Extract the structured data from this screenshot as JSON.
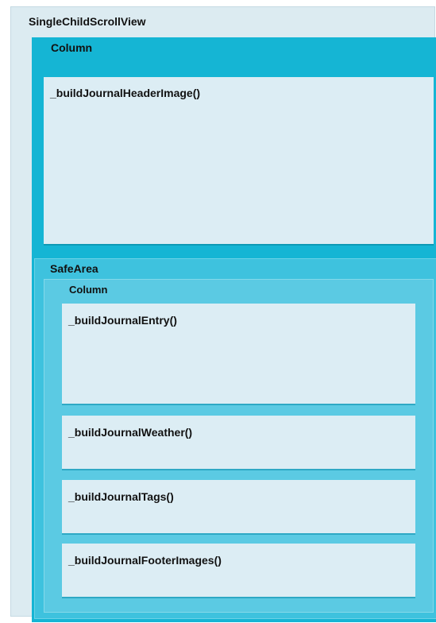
{
  "widgets": {
    "scroll_view": "SingleChildScrollView",
    "outer_column": "Column",
    "header_image": "_buildJournalHeaderImage()",
    "safe_area": "SafeArea",
    "inner_column": "Column",
    "entry": "_buildJournalEntry()",
    "weather": "_buildJournalWeather()",
    "tags": "_buildJournalTags()",
    "footer_images": "_buildJournalFooterImages()"
  },
  "colors": {
    "scroll_view_bg": "#dcebf1",
    "column_bg": "#15b5d4",
    "safe_area_bg": "#3ec2de",
    "inner_column_bg": "#5bcae3",
    "widget_bg": "#dcedf4"
  }
}
